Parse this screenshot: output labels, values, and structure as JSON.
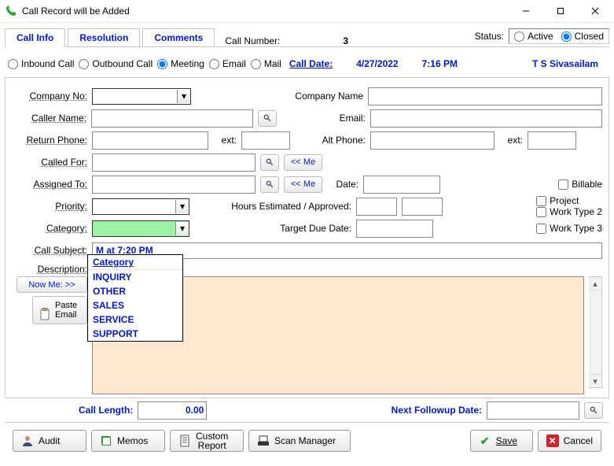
{
  "window": {
    "title": "Call Record will be Added"
  },
  "tabs": {
    "callinfo": "Call Info",
    "resolution": "Resolution",
    "comments": "Comments"
  },
  "header": {
    "callnum_label": "Call Number:",
    "callnum_value": "3",
    "status_label": "Status:",
    "status_active": "Active",
    "status_closed": "Closed",
    "status_selected": "closed"
  },
  "typerow": {
    "inbound": "Inbound Call",
    "outbound": "Outbound Call",
    "meeting": "Meeting",
    "email": "Email",
    "mail": "Mail",
    "selected": "meeting",
    "calldate_label": "Call Date:",
    "calldate": "4/27/2022",
    "calltime": "7:16 PM",
    "user": "T S Sivasailam"
  },
  "labels": {
    "company_no": "Company No:",
    "company_name": "Company Name",
    "caller_name": "Caller Name:",
    "email": "Email:",
    "return_phone": "Return Phone:",
    "ext1": "ext:",
    "alt_phone": "Alt Phone:",
    "ext2": "ext:",
    "called_for": "Called For:",
    "assigned_to": "Assigned To:",
    "date": "Date:",
    "priority": "Priority:",
    "hours": "Hours Estimated / Approved:",
    "category": "Category:",
    "target_due": "Target Due Date:",
    "call_subject": "Call Subject:",
    "description": "Description:",
    "call_length": "Call Length:",
    "next_followup": "Next Followup Date:"
  },
  "buttons": {
    "me1": "<< Me",
    "me2": "<< Me",
    "now_me": "Now Me: >>",
    "paste_email": "Paste\nEmail",
    "audit": "Audit",
    "memos": "Memos",
    "custom_report": "Custom\nReport",
    "scan_manager": "Scan Manager",
    "save": "Save",
    "cancel": "Cancel"
  },
  "checkboxes": {
    "billable": "Billable",
    "project": "Project",
    "worktype2": "Work Type 2",
    "worktype3": "Work Type 3"
  },
  "values": {
    "company_no": "",
    "company_name": "",
    "caller_name": "",
    "email": "",
    "return_phone": "",
    "ext1": "",
    "alt_phone": "",
    "ext2": "",
    "called_for": "",
    "assigned_to": "",
    "date": "",
    "priority": "",
    "hours_est": "",
    "hours_app": "",
    "category_selected": "",
    "target_due": "",
    "call_subject_visible": "M                              at  7:20 PM",
    "description": "",
    "call_length": "0.00",
    "next_followup": ""
  },
  "category_dropdown": {
    "header": "Category",
    "options": [
      "INQUIRY",
      "OTHER",
      "SALES",
      "SERVICE",
      "SUPPORT"
    ]
  }
}
